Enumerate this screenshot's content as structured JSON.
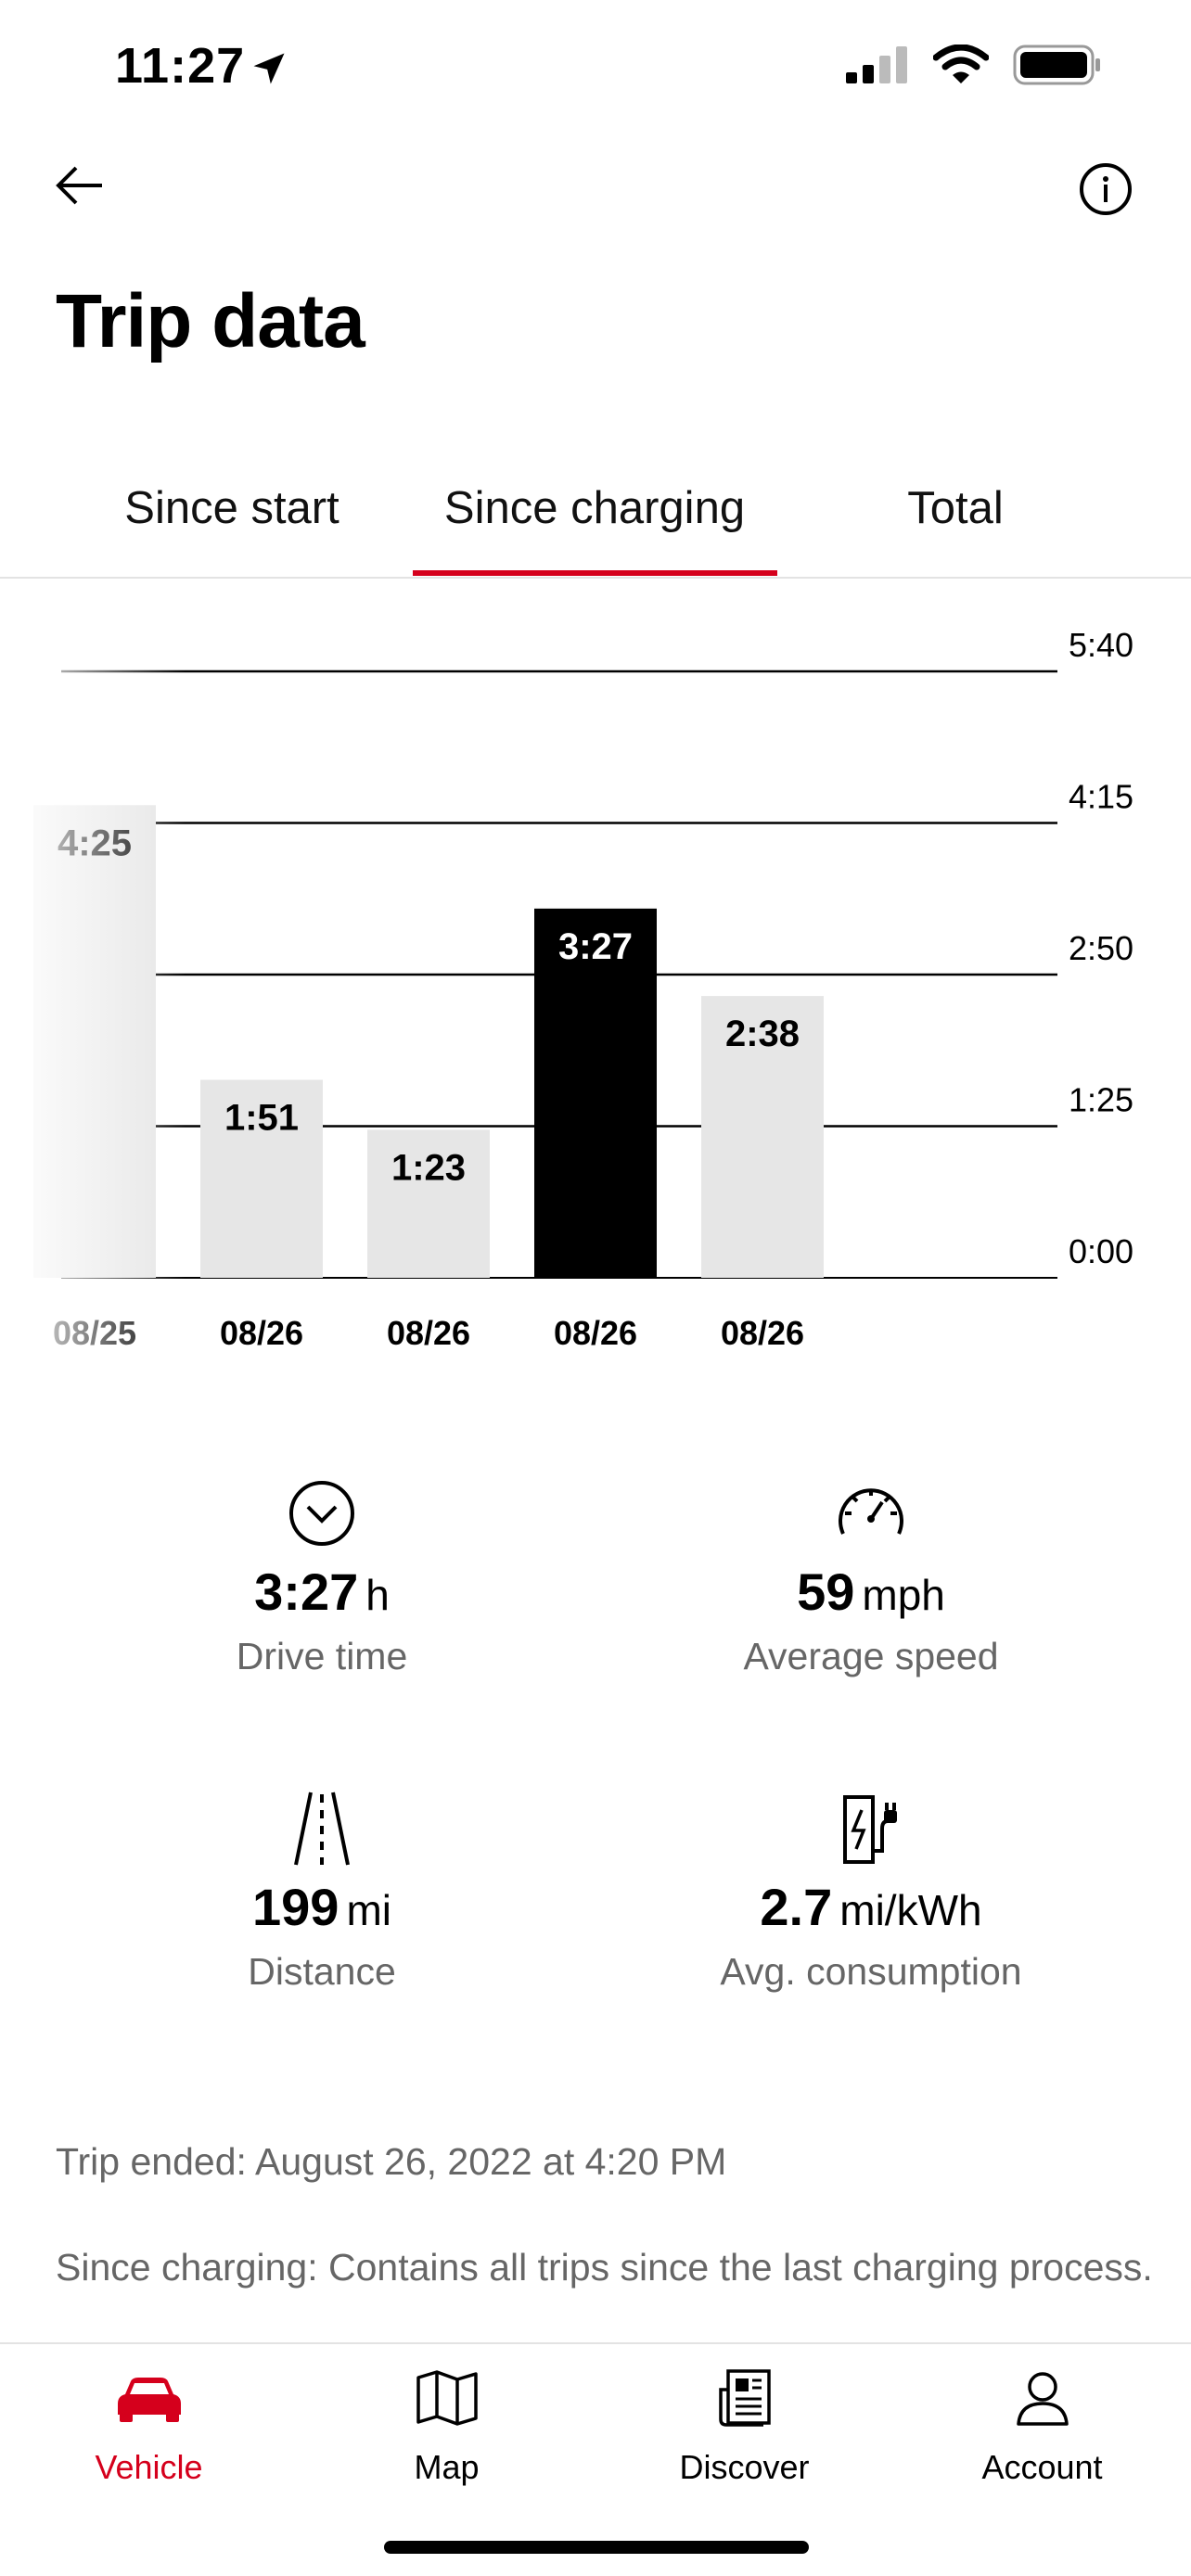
{
  "status_bar": {
    "time": "11:27",
    "location_icon": "location-arrow-icon",
    "signal_icon": "cellular-signal-icon",
    "wifi_icon": "wifi-icon",
    "battery_icon": "battery-icon"
  },
  "header": {
    "back_icon": "arrow-left-icon",
    "info_icon": "info-icon",
    "title": "Trip data"
  },
  "tabs": [
    {
      "label": "Since start",
      "selected": false
    },
    {
      "label": "Since charging",
      "selected": true
    },
    {
      "label": "Total",
      "selected": false
    }
  ],
  "colors": {
    "accent": "#d5001c",
    "bar_default": "#e6e6e6",
    "bar_selected": "#000000",
    "muted_text": "#666666"
  },
  "chart_data": {
    "type": "bar",
    "y_tick_labels": [
      "0:00",
      "1:25",
      "2:50",
      "4:15",
      "5:40"
    ],
    "ylim_minutes": [
      0,
      340
    ],
    "bars": [
      {
        "date": "08/25",
        "label": "4:25",
        "minutes": 265,
        "selected": false,
        "partially_visible": true
      },
      {
        "date": "08/26",
        "label": "1:51",
        "minutes": 111,
        "selected": false
      },
      {
        "date": "08/26",
        "label": "1:23",
        "minutes": 83,
        "selected": false
      },
      {
        "date": "08/26",
        "label": "3:27",
        "minutes": 207,
        "selected": true
      },
      {
        "date": "08/26",
        "label": "2:38",
        "minutes": 158,
        "selected": false
      }
    ],
    "grid": true
  },
  "stats": {
    "drive_time": {
      "icon": "chevron-circle-down-icon",
      "value": "3:27",
      "unit": "h",
      "label": "Drive time"
    },
    "average_speed": {
      "icon": "speedometer-icon",
      "value": "59",
      "unit": "mph",
      "label": "Average speed"
    },
    "distance": {
      "icon": "road-icon",
      "value": "199",
      "unit": "mi",
      "label": "Distance"
    },
    "avg_consumption": {
      "icon": "charging-station-icon",
      "value": "2.7",
      "unit": "mi/kWh",
      "label": "Avg. consumption"
    }
  },
  "notes": {
    "trip_ended": "Trip ended: August 26, 2022 at 4:20 PM",
    "since_charging": "Since charging: Contains all trips since the last charging process."
  },
  "bottom_nav": [
    {
      "label": "Vehicle",
      "icon": "car-icon",
      "active": true
    },
    {
      "label": "Map",
      "icon": "map-icon",
      "active": false
    },
    {
      "label": "Discover",
      "icon": "news-icon",
      "active": false
    },
    {
      "label": "Account",
      "icon": "user-icon",
      "active": false
    }
  ]
}
